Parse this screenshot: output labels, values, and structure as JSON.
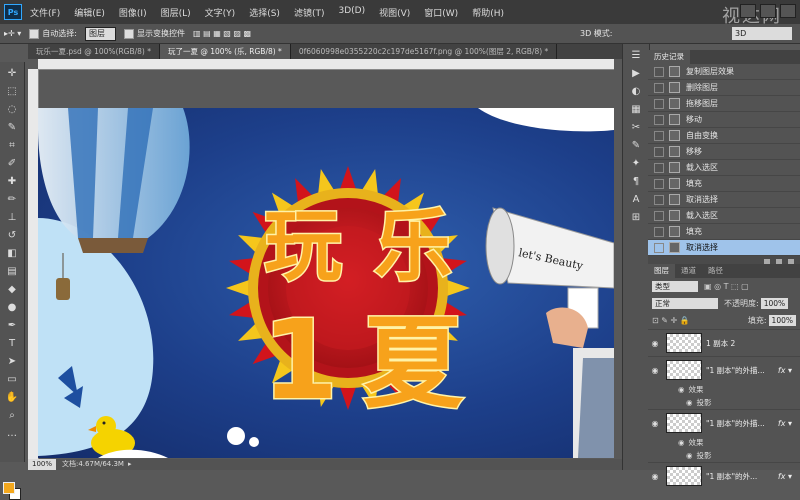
{
  "app": {
    "logo": "Ps",
    "watermark": "视达网"
  },
  "menu": [
    "文件(F)",
    "编辑(E)",
    "图像(I)",
    "图层(L)",
    "文字(Y)",
    "选择(S)",
    "滤镜(T)",
    "3D(D)",
    "视图(V)",
    "窗口(W)",
    "帮助(H)"
  ],
  "options": {
    "auto_select_label": "自动选择:",
    "auto_select_value": "图层",
    "show_transform_label": "显示变换控件",
    "mode_3d_label": "3D 模式:",
    "mode_3d_value": "3D"
  },
  "tabs": [
    "玩乐一夏.psd @ 100%(RGB/8) *",
    "玩了一夏 @ 100% (乐, RGB/8) *",
    "0f6060998e0355220c2c197de5167f.png @ 100%(图层 2, RGB/8) *"
  ],
  "status": {
    "zoom": "100%",
    "doc": "文档:4.67M/64.3M"
  },
  "canvas": {
    "title_chars": [
      "玩",
      "乐",
      "1",
      "夏"
    ],
    "megaphone_text": "let's Beauty"
  },
  "history": {
    "tabs": [
      "历史记录"
    ],
    "items": [
      "复制图层效果",
      "删除图层",
      "拖移图层",
      "移动",
      "自由变换",
      "移移",
      "载入选区",
      "填充",
      "取消选择",
      "载入选区",
      "填充",
      "取消选择"
    ],
    "selected_index": 11
  },
  "layers": {
    "tabs": [
      "图层",
      "通道",
      "路径"
    ],
    "kind_label": "类型",
    "blend_mode": "正常",
    "opacity_label": "不透明度:",
    "opacity_value": "100%",
    "fill_label": "填充:",
    "fill_value": "100%",
    "items": [
      {
        "name": "1 副本 2",
        "fx": false
      },
      {
        "name": "\"1 副本\"的外描...",
        "fx": true,
        "effects_label": "效果",
        "effect": "投影"
      },
      {
        "name": "\"1 副本\"的外描...",
        "fx": true,
        "effects_label": "效果",
        "effect": "投影"
      },
      {
        "name": "\"1 副本\"的外...",
        "fx": true
      }
    ]
  },
  "colors": {
    "accent": "#31a8ff",
    "selected": "#9fc3ea",
    "canvas_blue": "#1d3f8a",
    "title_orange": "#f7a21b",
    "sun_red": "#c8161d"
  }
}
